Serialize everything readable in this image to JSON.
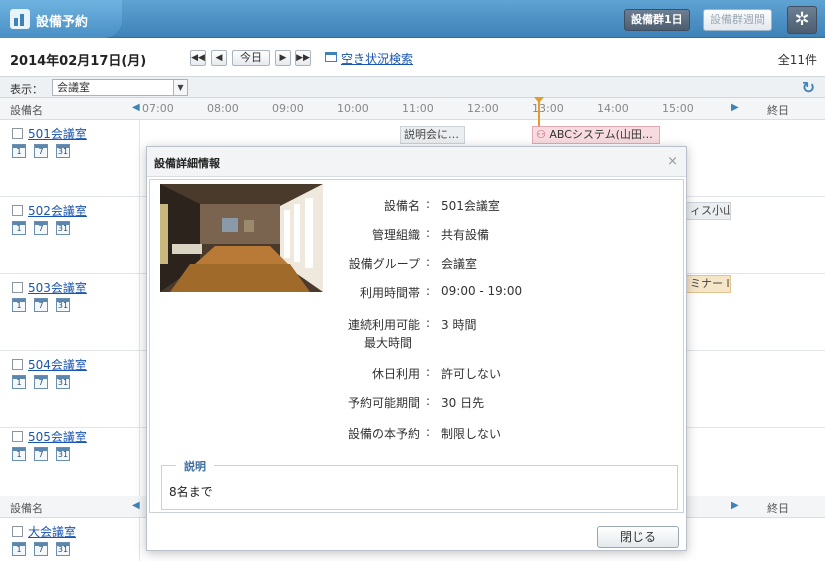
{
  "header": {
    "title": "設備予約",
    "btn_group_day": "設備群1日",
    "btn_group_week": "設備群週間"
  },
  "datebar": {
    "date": "2014年02月17日(月)",
    "today": "今日",
    "vacancy_search": "空き状況検索",
    "total": "全11件"
  },
  "display": {
    "label": "表示：",
    "selected": "会議室"
  },
  "timeline": {
    "col_name": "設備名",
    "all_day": "終日",
    "hours": [
      "07:00",
      "08:00",
      "09:00",
      "10:00",
      "11:00",
      "12:00",
      "13:00",
      "14:00",
      "15:00"
    ]
  },
  "facilities": [
    {
      "name": "501会議室"
    },
    {
      "name": "502会議室"
    },
    {
      "name": "503会議室"
    },
    {
      "name": "504会議室"
    },
    {
      "name": "505会議室"
    },
    {
      "name": "大会議室"
    }
  ],
  "cal_icons": [
    "1",
    "7",
    "31"
  ],
  "appointments": {
    "a1": "説明会に…",
    "a2": "ABCシステム(山田…",
    "a3": "ィス小山",
    "a4": "ミナー l"
  },
  "modal": {
    "title": "設備詳細情報",
    "close_x": "×",
    "details": [
      {
        "label": "設備名",
        "value": "501会議室"
      },
      {
        "label": "管理組織",
        "value": "共有設備"
      },
      {
        "label": "設備グループ",
        "value": "会議室"
      },
      {
        "label": "利用時間帯",
        "value": "09:00 - 19:00"
      },
      {
        "label": "連続利用可能",
        "label2": "最大時間",
        "value": "3 時間"
      },
      {
        "label": "休日利用",
        "value": "許可しない"
      },
      {
        "label": "予約可能期間",
        "value": "30 日先"
      },
      {
        "label": "設備の本予約",
        "value": "制限しない"
      }
    ],
    "desc_legend": "説明",
    "desc_text": "8名まで",
    "close_button": "閉じる"
  },
  "colors": {
    "header_blue": "#4a8fc4",
    "link_blue": "#1a55b0",
    "now_marker": "#e59a2b"
  }
}
